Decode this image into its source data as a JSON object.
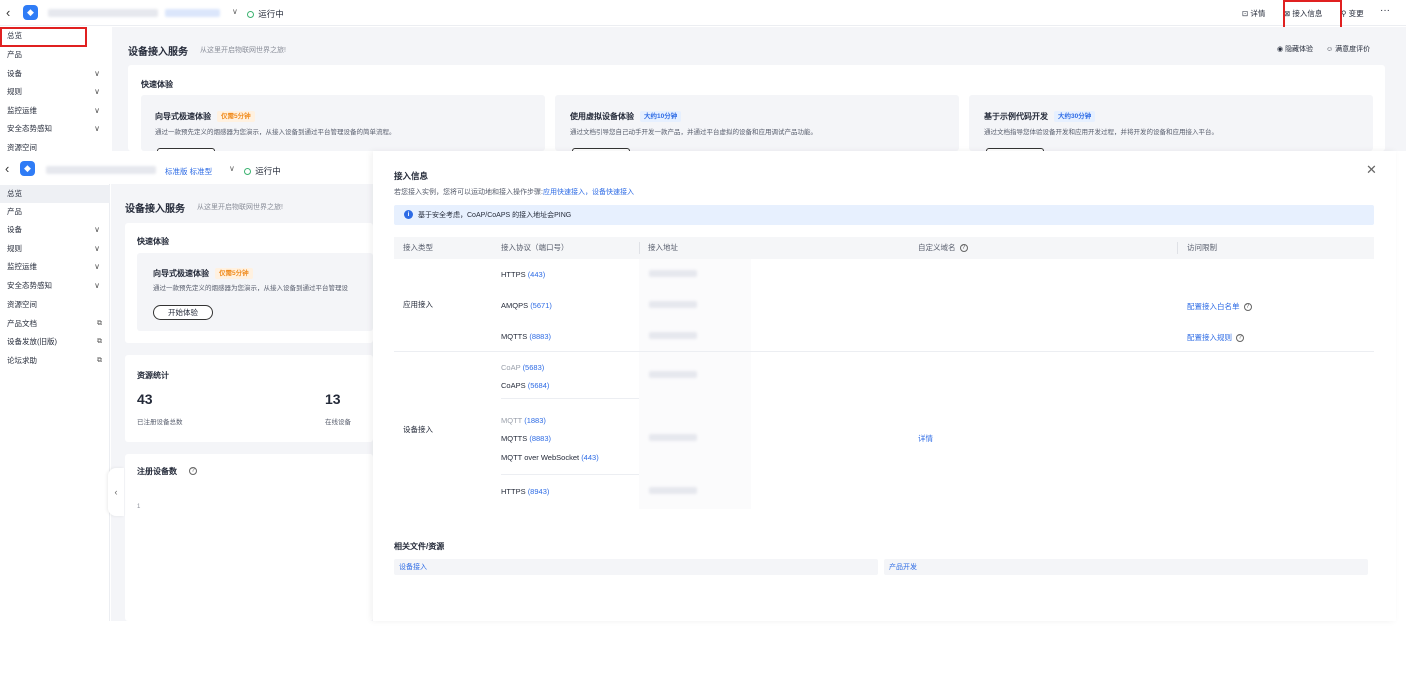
{
  "back_layer": {
    "header": {
      "status": "运行中",
      "actions": {
        "details": "详情",
        "access_info": "接入信息",
        "change": "变更",
        "more": "···"
      }
    },
    "sidebar": [
      {
        "label": "总览",
        "expandable": false
      },
      {
        "label": "产品",
        "expandable": false
      },
      {
        "label": "设备",
        "expandable": true
      },
      {
        "label": "规则",
        "expandable": true
      },
      {
        "label": "监控运维",
        "expandable": true
      },
      {
        "label": "安全态势感知",
        "expandable": true
      },
      {
        "label": "资源空间",
        "expandable": false
      }
    ],
    "page_title": "设备接入服务",
    "page_subtitle": "从这里开启物联网世界之旅!",
    "hide_experience": "隐藏体验",
    "satisfaction": "满意度评价",
    "quick_section": "快速体验",
    "quick_cards": [
      {
        "title": "向导式极速体验",
        "tag": "仅需5分钟",
        "tag_color": "orange",
        "desc": "通过一款预先定义的烟感器为您演示，从接入设备到通过平台管理设备的简单流程。"
      },
      {
        "title": "使用虚拟设备体验",
        "tag": "大约10分钟",
        "tag_color": "blue",
        "desc": "通过文档引导您自己动手开发一款产品，并通过平台虚拟的设备和应用调试产品功能。"
      },
      {
        "title": "基于示例代码开发",
        "tag": "大约30分钟",
        "tag_color": "blue",
        "desc": "通过文档指导您体验设备开发和应用开发过程，并将开发的设备和应用接入平台。"
      }
    ]
  },
  "front_layer": {
    "header": {
      "edition_label": "标准版 标准型",
      "status": "运行中"
    },
    "sidebar": [
      {
        "label": "总览",
        "suffix": ""
      },
      {
        "label": "产品",
        "suffix": ""
      },
      {
        "label": "设备",
        "suffix": "chevron"
      },
      {
        "label": "规则",
        "suffix": "chevron"
      },
      {
        "label": "监控运维",
        "suffix": "chevron"
      },
      {
        "label": "安全态势感知",
        "suffix": "chevron"
      },
      {
        "label": "资源空间",
        "suffix": ""
      },
      {
        "label": "产品文档",
        "suffix": "external"
      },
      {
        "label": "设备发放(旧版)",
        "suffix": "external"
      },
      {
        "label": "论坛求助",
        "suffix": "external"
      }
    ],
    "page_title": "设备接入服务",
    "page_subtitle": "从这里开启物联网世界之旅!",
    "quick_section": "快速体验",
    "quick_card": {
      "title": "向导式极速体验",
      "tag": "仅需5分钟",
      "desc": "通过一款预先定义的烟感器为您演示，从接入设备到通过平台管理设",
      "button": "开始体验"
    },
    "stats_section": "资源统计",
    "stats": [
      {
        "value": "43",
        "label": "已注册设备总数"
      },
      {
        "value": "13",
        "label": "在线设备"
      }
    ],
    "register_title": "注册设备数",
    "register_axis": "1"
  },
  "drawer": {
    "title": "接入信息",
    "intro": "若您接入实例，您将可以运动地和接入操作步骤:",
    "links": [
      "应用快速接入",
      "设备快速接入"
    ],
    "link_sep": "，",
    "notice": "基于安全考虑，CoAP/CoAPS 的接入地址会PING",
    "columns": [
      "接入类型",
      "接入协议（端口号）",
      "接入地址",
      "自定义域名",
      "访问限制"
    ],
    "groups": [
      {
        "type": "应用接入",
        "protocols": [
          {
            "name": "HTTPS",
            "port": "(443)"
          },
          {
            "name": "AMQPS",
            "port": "(5671)"
          },
          {
            "name": "MQTTS",
            "port": "(8883)"
          }
        ],
        "access_links": [
          "配置接入白名单",
          "配置接入规则"
        ]
      },
      {
        "type": "设备接入",
        "protocols": [
          {
            "name": "CoAP",
            "port": "(5683)"
          },
          {
            "name": "CoAPS",
            "port": "(5684)"
          },
          {
            "name": "MQTT",
            "port": "(1883)"
          },
          {
            "name": "MQTTS",
            "port": "(8883)"
          },
          {
            "name": "MQTT over WebSocket",
            "port": "(443)"
          },
          {
            "name": "HTTPS",
            "port": "(8943)"
          }
        ],
        "domain_link": "详情"
      }
    ],
    "related_title": "相关文件/资源",
    "related": [
      "设备接入",
      "产品开发"
    ]
  }
}
